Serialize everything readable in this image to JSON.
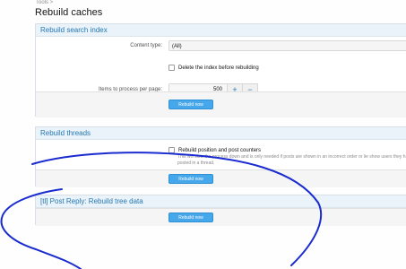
{
  "breadcrumb": "Tools  >",
  "page_title": "Rebuild caches",
  "search_index": {
    "title": "Rebuild search index",
    "content_type_label": "Content type:",
    "content_type_value": "(All)",
    "delete_label": "Delete the index before rebuilding",
    "items_label": "Items to process per page:",
    "items_value": "500",
    "plus": "+",
    "minus": "−",
    "button": "Rebuild now"
  },
  "threads": {
    "title": "Rebuild threads",
    "position_label": "Rebuild position and post counters",
    "help_text": "This will slow the process down and is only needed if posts are shown in an incorrect order or lie show users they have posted in a thread.",
    "button": "Rebuild now"
  },
  "tree": {
    "title": "[tl] Post Reply: Rebuild tree data",
    "button": "Rebuild now"
  },
  "colors": {
    "accent": "#2577b1",
    "header_bg": "#eaf3fa",
    "button": "#47a7eb",
    "scribble": "#1a2bd0"
  }
}
